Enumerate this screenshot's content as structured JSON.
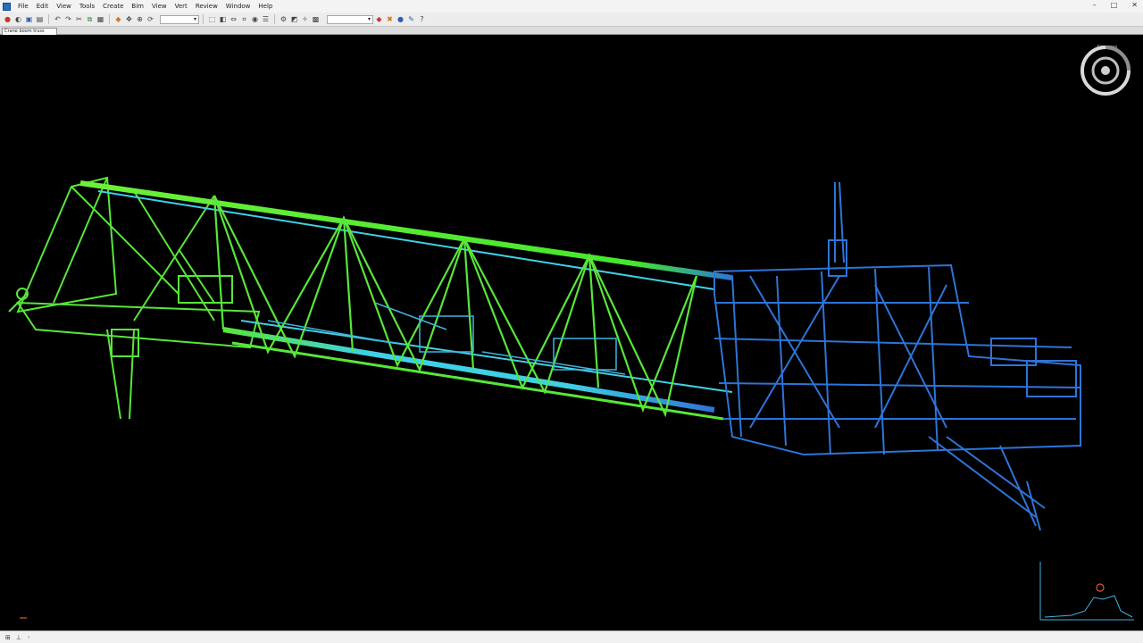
{
  "window": {
    "menu": [
      "File",
      "Edit",
      "View",
      "Tools",
      "Create",
      "Bim",
      "View",
      "Vert",
      "Review",
      "Window",
      "Help"
    ],
    "controls": [
      "–",
      "□",
      "✕"
    ]
  },
  "toolbar": {
    "combo1": "",
    "combo2": "",
    "icons": [
      "new-icon",
      "open-icon",
      "save-icon",
      "print-icon",
      "undo-icon",
      "redo-icon",
      "cut-icon",
      "copy-icon",
      "paste-icon",
      "select-icon",
      "pan-icon",
      "zoom-icon",
      "orbit-icon",
      "wireframe-icon",
      "shaded-icon",
      "measure-icon",
      "section-icon",
      "camera-icon",
      "layer-icon",
      "settings-icon",
      "render-icon",
      "light-icon",
      "material-icon",
      "help-icon"
    ]
  },
  "document_tab": "Crane boom truss",
  "navcube": {
    "label": "Compass"
  },
  "colors": {
    "green": "#58e63a",
    "lime": "#8bf04a",
    "cyan": "#3fd0e6",
    "blue": "#2e74d8",
    "background": "#000000"
  }
}
